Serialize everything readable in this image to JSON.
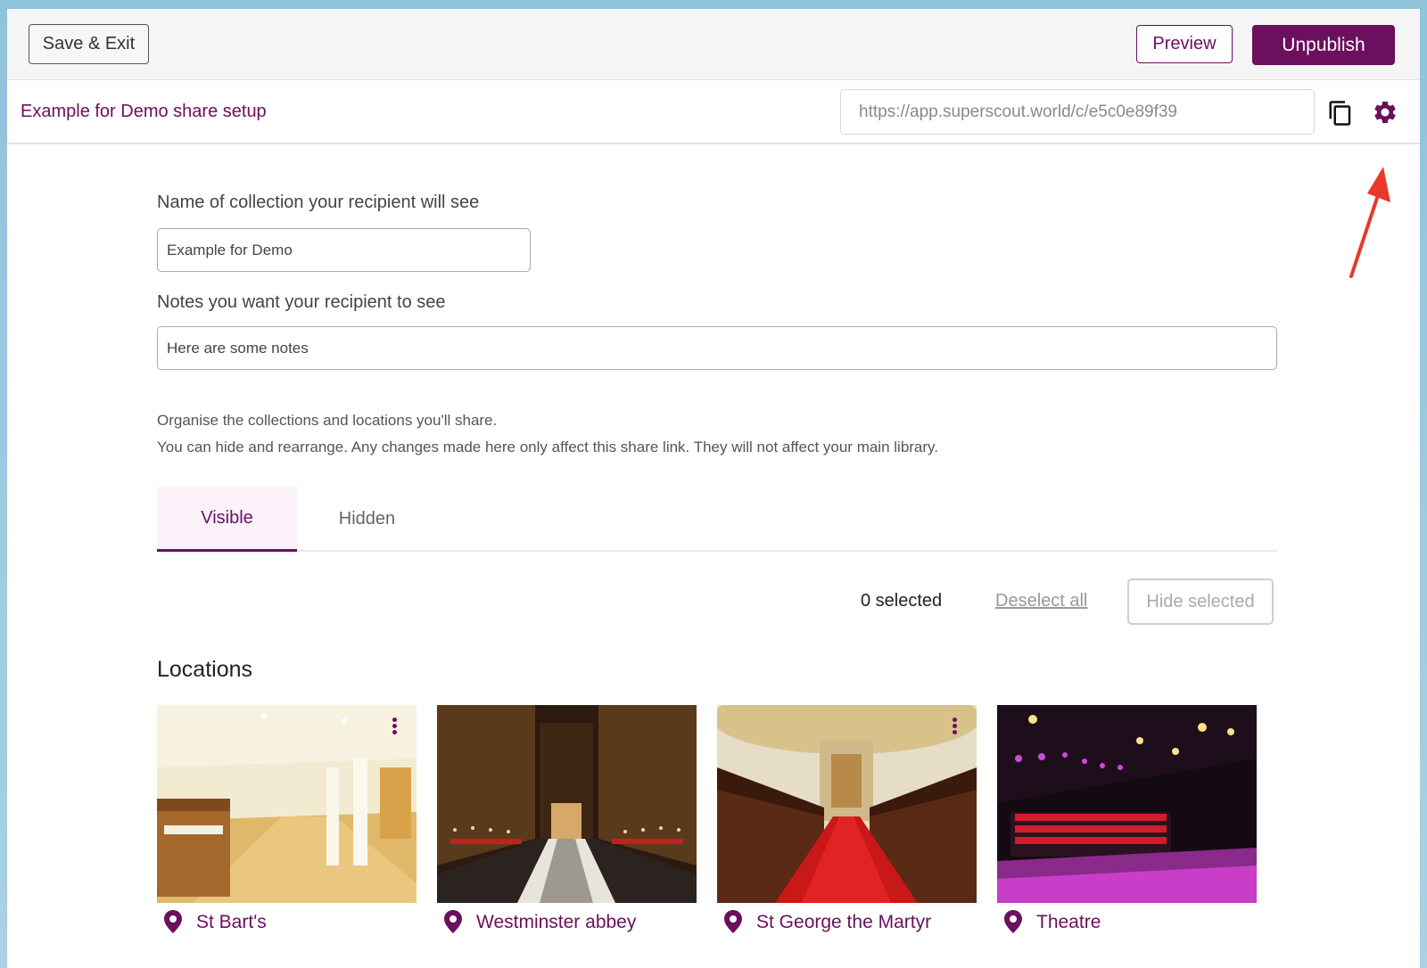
{
  "toolbar": {
    "save_exit_label": "Save & Exit",
    "preview_label": "Preview",
    "unpublish_label": "Unpublish"
  },
  "share": {
    "title": "Example for Demo share setup",
    "url": "https://app.superscout.world/c/e5c0e89f39"
  },
  "form": {
    "collection_name_label": "Name of collection your recipient will see",
    "collection_name_value": "Example for Demo",
    "notes_label": "Notes you want your recipient to see",
    "notes_value": "Here are some notes"
  },
  "help": {
    "line1": "Organise the collections and locations you'll share.",
    "line2": "You can hide and rearrange. Any changes made here only affect this share link. They will not affect your main library."
  },
  "tabs": [
    {
      "label": "Visible",
      "active": true
    },
    {
      "label": "Hidden",
      "active": false
    }
  ],
  "selection": {
    "count_text": "0 selected",
    "deselect_label": "Deselect all",
    "hide_label": "Hide selected"
  },
  "locations": {
    "title": "Locations",
    "items": [
      {
        "name": "St Bart's",
        "scene": "hall"
      },
      {
        "name": "Westminster abbey",
        "scene": "abbey"
      },
      {
        "name": "St George the Martyr",
        "scene": "church"
      },
      {
        "name": "Theatre",
        "scene": "theatre"
      }
    ]
  },
  "colors": {
    "brand": "#6b0f5e",
    "annotation_arrow": "#e8392b"
  },
  "icons": {
    "copy": "copy-icon",
    "settings": "gear-icon",
    "location": "map-pin-icon",
    "more": "kebab-menu-icon"
  }
}
